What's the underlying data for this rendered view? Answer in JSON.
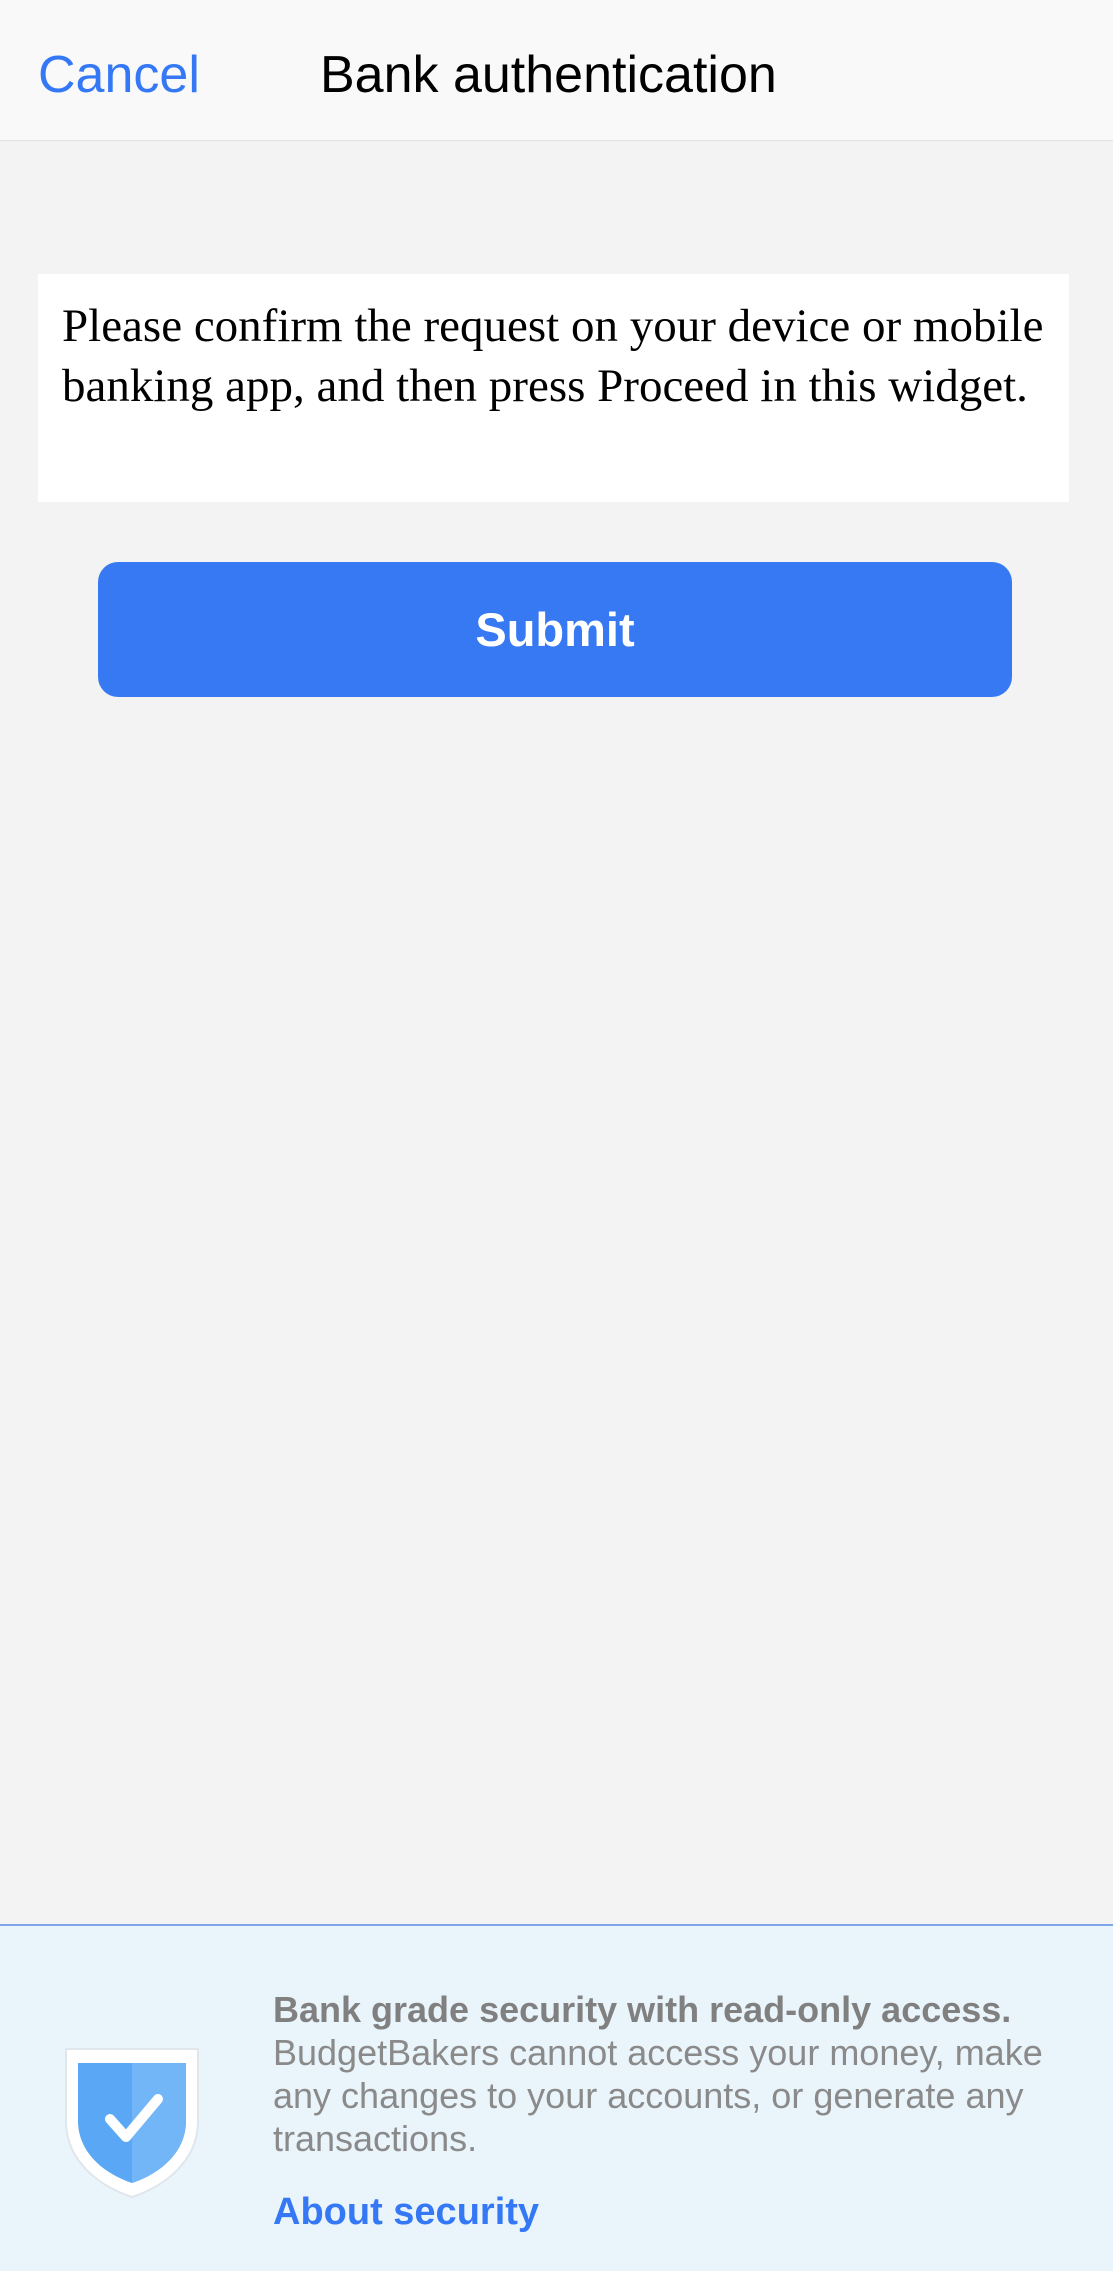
{
  "navbar": {
    "cancel_label": "Cancel",
    "title": "Bank authentication"
  },
  "message": {
    "text": "Please confirm the request on your device or mobile banking app, and then press Proceed in this widget."
  },
  "actions": {
    "submit_label": "Submit"
  },
  "security": {
    "icon": "shield-check-icon",
    "heading": "Bank grade security with read-only access.",
    "body": "BudgetBakers cannot access your money, make any changes to your accounts, or generate any transactions.",
    "link_label": "About security"
  },
  "colors": {
    "accent": "#3478f6",
    "button": "#3779f3",
    "background": "#f3f3f3",
    "footer_background": "#eaf4fb",
    "shield": "#5aa8f5"
  }
}
